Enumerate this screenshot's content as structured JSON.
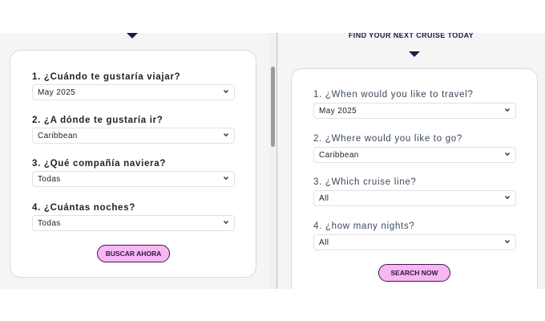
{
  "left": {
    "questions": [
      {
        "label": "1. ¿Cuándo te gustaría viajar?",
        "value": "May 2025"
      },
      {
        "label": "2. ¿A dónde te gustaría ir?",
        "value": "Caribbean"
      },
      {
        "label": "3. ¿Qué compañía naviera?",
        "value": "Todas"
      },
      {
        "label": "4. ¿Cuántas noches?",
        "value": "Todas"
      }
    ],
    "button_label": "BUSCAR AHORA"
  },
  "right": {
    "heading": "FIND YOUR NEXT CRUISE TODAY",
    "questions": [
      {
        "label": "1. ¿When would you like to travel?",
        "value": "May 2025"
      },
      {
        "label": "2. ¿Where would you like to go?",
        "value": "Caribbean"
      },
      {
        "label": "3. ¿Which cruise line?",
        "value": "All"
      },
      {
        "label": "4. ¿how many nights?",
        "value": "All"
      }
    ],
    "button_label": "SEARCH NOW"
  },
  "colors": {
    "button_bg": "#f7b6f4",
    "button_border": "#3a1b4a",
    "heading": "#1a1c4a"
  }
}
